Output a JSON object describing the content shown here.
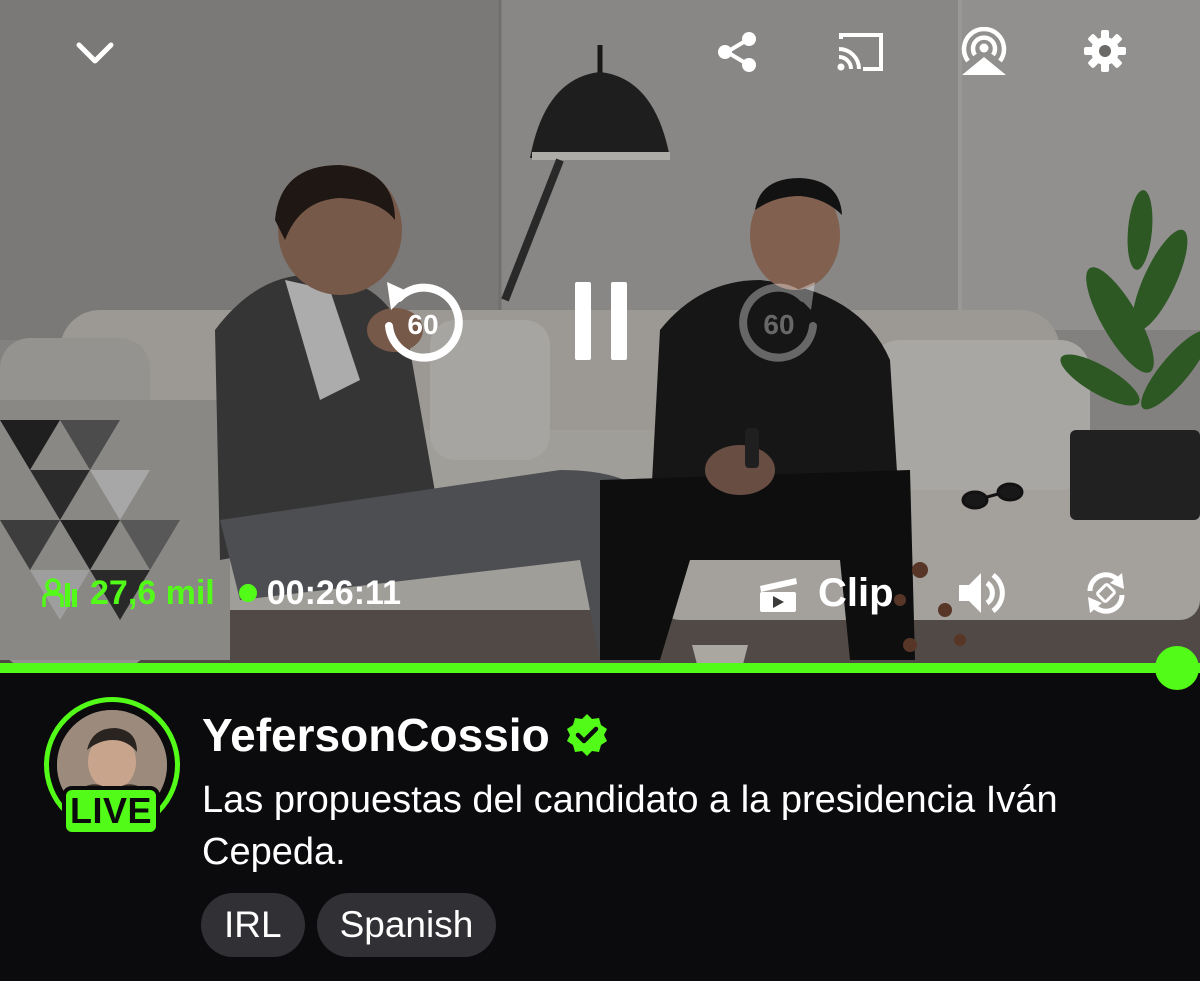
{
  "player": {
    "controls_top": {
      "collapse_icon": "chevron-down-icon",
      "share_icon": "share-icon",
      "cast_icon": "cast-icon",
      "airplay_icon": "airplay-icon",
      "settings_icon": "gear-icon"
    },
    "center_controls": {
      "rewind_seconds": "60",
      "forward_seconds": "60",
      "pause_icon": "pause-icon"
    },
    "viewers": "27,6 mil",
    "elapsed": "00:26:11",
    "clip_label": "Clip",
    "progress": 0.98
  },
  "channel": {
    "name": "YefersonCossio",
    "verified_icon": "verified-badge-icon",
    "live_badge": "LIVE",
    "title": "Las propuestas del candidato a la presidencia Iván Cepeda."
  },
  "tags": [
    "IRL",
    "Spanish"
  ],
  "colors": {
    "accent": "#53fc18",
    "background": "#0b0b0d",
    "tag_bg": "#303035"
  }
}
